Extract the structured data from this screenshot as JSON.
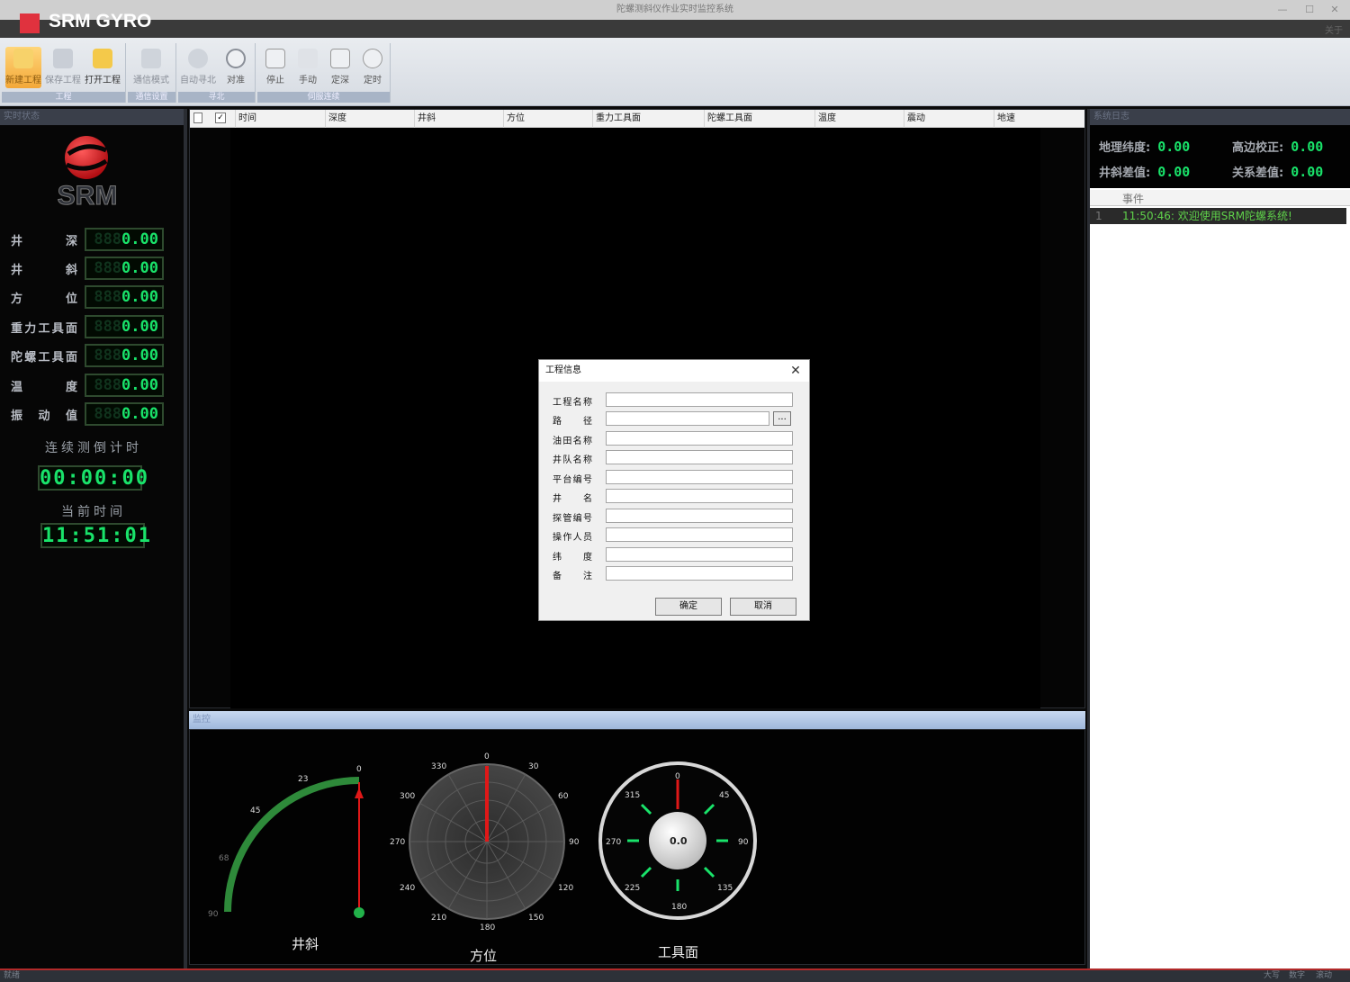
{
  "window": {
    "title": "陀螺测斜仪作业实时监控系统"
  },
  "ribbon": {
    "groups": [
      {
        "label": "工程",
        "buttons": [
          "新建工程",
          "保存工程",
          "打开工程"
        ]
      },
      {
        "label": "通信设置",
        "buttons": [
          "通信模式"
        ]
      },
      {
        "label": "寻北",
        "buttons": [
          "自动寻北",
          "对准"
        ]
      },
      {
        "label": "伺服连续",
        "buttons": [
          "停止",
          "手动",
          "定深",
          "定时"
        ]
      }
    ],
    "right_tab": "关于"
  },
  "brand": {
    "name": "SRM GYRO"
  },
  "left_panel": {
    "header": "实时状态",
    "logo_text": "SRM",
    "params": [
      {
        "label": "井深",
        "value": "0.00"
      },
      {
        "label": "井斜",
        "value": "0.00"
      },
      {
        "label": "方位",
        "value": "0.00"
      },
      {
        "label": "重力工具面",
        "value": "0.00"
      },
      {
        "label": "陀螺工具面",
        "value": "0.00"
      },
      {
        "label": "温度",
        "value": "0.00"
      },
      {
        "label": "振动值",
        "value": "0.00"
      }
    ],
    "countdown_title": "连续测倒计时",
    "countdown": "00:00:00",
    "time_title": "当前时间",
    "current_time": "11:51:01"
  },
  "grid": {
    "columns": [
      "时间",
      "深度",
      "井斜",
      "方位",
      "重力工具面",
      "陀螺工具面",
      "温度",
      "震动",
      "地速"
    ]
  },
  "dialog": {
    "title": "工程信息",
    "fields": [
      {
        "label": "工程名称",
        "value": ""
      },
      {
        "label": "路径",
        "value": ""
      },
      {
        "label": "油田名称",
        "value": ""
      },
      {
        "label": "井队名称",
        "value": ""
      },
      {
        "label": "平台编号",
        "value": ""
      },
      {
        "label": "井名",
        "value": ""
      },
      {
        "label": "探管编号",
        "value": ""
      },
      {
        "label": "操作人员",
        "value": ""
      },
      {
        "label": "纬度",
        "value": ""
      },
      {
        "label": "备注",
        "value": ""
      }
    ],
    "browse_label": "...",
    "ok_label": "确定",
    "cancel_label": "取消"
  },
  "monitor": {
    "header": "监控",
    "inclination": {
      "title": "井斜",
      "ticks": [
        "0",
        "23",
        "45",
        "68",
        "90"
      ]
    },
    "azimuth": {
      "title": "方位",
      "ticks": [
        "0",
        "30",
        "60",
        "90",
        "120",
        "150",
        "180",
        "210",
        "240",
        "270",
        "300",
        "330"
      ]
    },
    "toolface": {
      "title": "工具面",
      "value": "0.0",
      "ticks": [
        "0",
        "45",
        "90",
        "135",
        "180",
        "225",
        "270",
        "315"
      ]
    }
  },
  "right_panel": {
    "header": "系统日志",
    "items": [
      {
        "label": "地理纬度:",
        "value": "0.00"
      },
      {
        "label": "高边校正:",
        "value": "0.00"
      },
      {
        "label": "井斜差值:",
        "value": "0.00"
      },
      {
        "label": "关系差值:",
        "value": "0.00"
      }
    ],
    "events_header": "事件",
    "events": [
      {
        "index": "1",
        "text": "11:50:46: 欢迎使用SRM陀螺系统!"
      }
    ]
  },
  "statusbar": {
    "left": "就绪",
    "right": [
      "大写",
      "数字",
      "滚动"
    ]
  },
  "colors": {
    "lcd_green": "#19e36a",
    "brand_red": "#e0323e",
    "needle_red": "#e01818"
  }
}
